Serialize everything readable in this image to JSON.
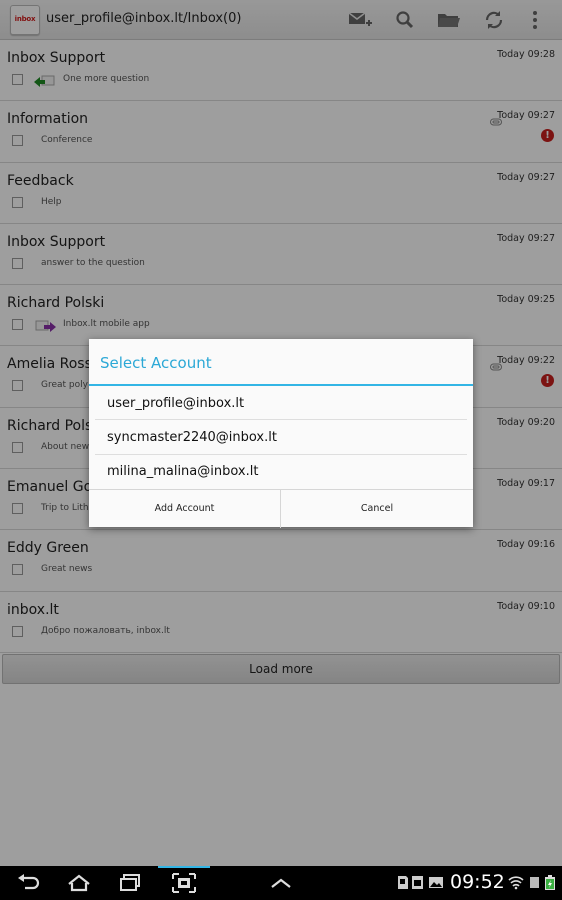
{
  "app": {
    "logo_text": "inbox",
    "title": "user_profile@inbox.lt/Inbox(0)",
    "actions": [
      "compose-icon",
      "search-icon",
      "folder-icon",
      "refresh-icon",
      "overflow-menu-icon"
    ]
  },
  "messages": [
    {
      "sender": "Inbox Support",
      "subject": "One more question",
      "time": "Today 09:28",
      "icon": "replied-arrow-icon",
      "attachment": false,
      "alert": false
    },
    {
      "sender": "Information",
      "subject": "Conference",
      "time": "Today 09:27",
      "icon": "",
      "attachment": true,
      "alert": true
    },
    {
      "sender": "Feedback",
      "subject": "Help",
      "time": "Today 09:27",
      "icon": "",
      "attachment": false,
      "alert": false
    },
    {
      "sender": "Inbox Support",
      "subject": "answer to the question",
      "time": "Today 09:27",
      "icon": "",
      "attachment": false,
      "alert": false
    },
    {
      "sender": "Richard Polski",
      "subject": "Inbox.lt mobile app",
      "time": "Today 09:25",
      "icon": "forwarded-arrow-icon",
      "attachment": false,
      "alert": false
    },
    {
      "sender": "Amelia Ross",
      "subject": "Great poly",
      "time": "Today 09:22",
      "icon": "",
      "attachment": true,
      "alert": true
    },
    {
      "sender": "Richard Polsk",
      "subject": "About new",
      "time": "Today 09:20",
      "icon": "",
      "attachment": false,
      "alert": false
    },
    {
      "sender": "Emanuel Gon",
      "subject": "Trip to Lith",
      "time": "Today 09:17",
      "icon": "",
      "attachment": false,
      "alert": false
    },
    {
      "sender": "Eddy Green",
      "subject": "Great news",
      "time": "Today 09:16",
      "icon": "",
      "attachment": false,
      "alert": false
    },
    {
      "sender": "inbox.lt",
      "subject": "Добро пожаловать, inbox.lt",
      "time": "Today 09:10",
      "icon": "",
      "attachment": false,
      "alert": false
    }
  ],
  "load_more_label": "Load more",
  "dialog": {
    "title": "Select Account",
    "accounts": [
      "user_profile@inbox.lt",
      "syncmaster2240@inbox.lt",
      "milina_malina@inbox.lt"
    ],
    "add_button": "Add Account",
    "cancel_button": "Cancel"
  },
  "system_bar": {
    "time": "09:52",
    "nav_icons": [
      "back-icon",
      "home-icon",
      "recent-apps-icon",
      "screenshot-icon",
      "up-arrow-icon"
    ],
    "status_icons": [
      "sd-card-icon",
      "sim-icon",
      "gallery-icon",
      "wifi-icon",
      "battery-icon"
    ]
  },
  "colors": {
    "accent": "#33b5e5",
    "alert": "#c8201d",
    "logo": "#d21d1d"
  }
}
